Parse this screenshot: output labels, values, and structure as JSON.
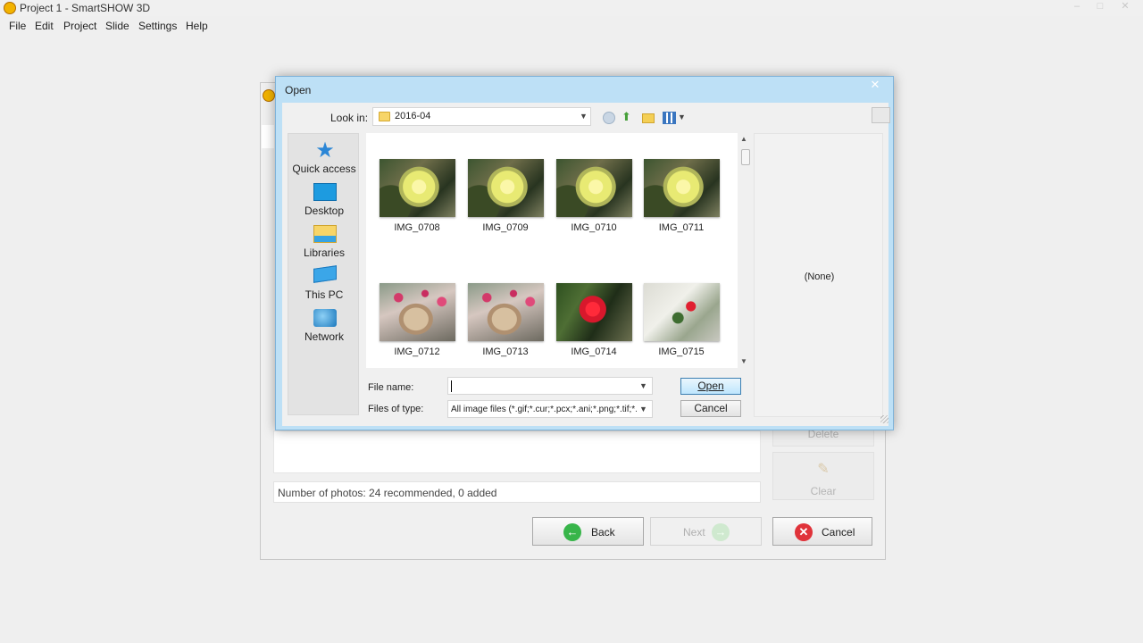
{
  "app": {
    "title": "Project 1 - SmartSHOW 3D",
    "menu": [
      "File",
      "Edit",
      "Project",
      "Slide",
      "Settings",
      "Help"
    ]
  },
  "wizard": {
    "status_text": "Number of photos: 24 recommended, 0 added",
    "delete_label": "Delete",
    "clear_label": "Clear",
    "back_label": "Back",
    "next_label": "Next",
    "cancel_label": "Cancel"
  },
  "dialog": {
    "title": "Open",
    "look_in_label": "Look in:",
    "look_in_value": "2016-04",
    "places": [
      {
        "label": "Quick access",
        "icon": "star-icon"
      },
      {
        "label": "Desktop",
        "icon": "desktop-icon"
      },
      {
        "label": "Libraries",
        "icon": "libraries-icon"
      },
      {
        "label": "This PC",
        "icon": "computer-icon"
      },
      {
        "label": "Network",
        "icon": "network-icon"
      }
    ],
    "files": [
      {
        "name": "IMG_0708"
      },
      {
        "name": "IMG_0709"
      },
      {
        "name": "IMG_0710"
      },
      {
        "name": "IMG_0711"
      },
      {
        "name": "IMG_0712"
      },
      {
        "name": "IMG_0713"
      },
      {
        "name": "IMG_0714"
      },
      {
        "name": "IMG_0715"
      }
    ],
    "file_name_label": "File name:",
    "file_name_value": "",
    "files_of_type_label": "Files of type:",
    "files_of_type_value": "All image files (*.gif;*.cur;*.pcx;*.ani;*.png;*.tif;*.j",
    "open_label": "Open",
    "cancel_label": "Cancel",
    "preview_text": "(None)"
  },
  "colors": {
    "dialog_titlebar": "#bde0f6",
    "primary_button": "#bee6fd",
    "back_icon": "#38b54a",
    "cancel_icon": "#e0333a"
  }
}
